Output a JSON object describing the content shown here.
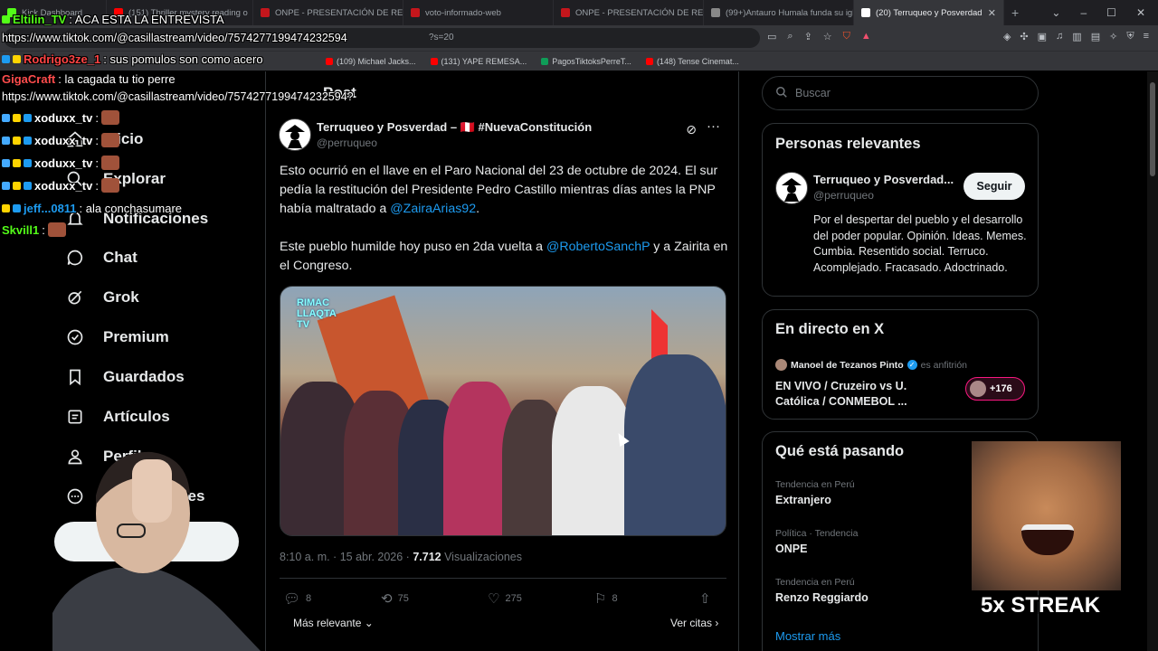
{
  "browser": {
    "tabs": [
      {
        "label": "Kick Dashboard",
        "color": "#53fc18"
      },
      {
        "label": "(151) Thriller mystery reading o",
        "color": "#ff0000"
      },
      {
        "label": "ONPE - PRESENTACIÓN DE RESULT",
        "color": "#c4161c"
      },
      {
        "label": "voto-informado-web",
        "color": "#c4161c"
      },
      {
        "label": "ONPE - PRESENTACIÓN DE RESULT",
        "color": "#c4161c"
      },
      {
        "label": "(99+)Antauro Humala funda su igle",
        "color": "#000000"
      },
      {
        "label": "(20) Terruqueo y Posverdad",
        "color": "#000000",
        "active": true
      }
    ],
    "url_partial": "?s=20",
    "bookmarks": [
      {
        "label": "(109) Michael Jacks...",
        "color": "#ff0000"
      },
      {
        "label": "(131) YAPE REMESA...",
        "color": "#ff0000"
      },
      {
        "label": "PagosTiktoksPerreT...",
        "color": "#0f9d58"
      },
      {
        "label": "(148) Tense Cinemat...",
        "color": "#ff0000"
      }
    ]
  },
  "nav": {
    "items": [
      {
        "label": "Inicio",
        "icon": "home-icon"
      },
      {
        "label": "Explorar",
        "icon": "search-icon"
      },
      {
        "label": "Notificaciones",
        "icon": "bell-icon"
      },
      {
        "label": "Chat",
        "icon": "chat-icon"
      },
      {
        "label": "Grok",
        "icon": "grok-icon"
      },
      {
        "label": "Premium",
        "icon": "premium-icon"
      },
      {
        "label": "Guardados",
        "icon": "bookmark-icon"
      },
      {
        "label": "Artículos",
        "icon": "articles-icon"
      },
      {
        "label": "Perfil",
        "icon": "user-icon"
      },
      {
        "label": "Más opciones",
        "icon": "more-circle-icon"
      }
    ]
  },
  "post": {
    "header_title": "Post",
    "author_name": "Terruqueo y Posverdad – 🇵🇪 #NuevaConstitución",
    "author_handle": "@perruqueo",
    "paragraph1_text": "Esto ocurrió en el llave en el Paro Nacional del 23 de octubre de 2024. El sur pedía la restitución del Presidente Pedro Castillo mientras días antes la PNP había maltratado a ",
    "paragraph1_mention": "@ZairaArias92",
    "paragraph1_end": ".",
    "paragraph2_text": "Este pueblo humilde hoy puso en 2da vuelta a ",
    "paragraph2_mention": "@RobertoSanchP",
    "paragraph2_end": " y a Zairita en el Congreso.",
    "media_logo_line1": "RIMAC",
    "media_logo_line2": "LLAQTA",
    "media_logo_line3": "TV",
    "timestamp": "8:10 a. m. · 15 abr. 2026 · ",
    "views_count": "7.712",
    "views_label": " Visualizaciones",
    "replies": "8",
    "reposts": "75",
    "likes": "275",
    "bookmarks": "8",
    "sort_label": "Más relevante",
    "quotes_label": "Ver citas"
  },
  "right": {
    "search_placeholder": "Buscar",
    "relevant_title": "Personas relevantes",
    "relevant_name": "Terruqueo y Posverdad...",
    "relevant_handle": "@perruqueo",
    "follow_label": "Seguir",
    "relevant_bio": "Por el despertar del pueblo y el desarrollo del poder popular. Opinión. Ideas. Memes. Cumbia. Resentido social. Terruco. Acomplejado. Fracasado. Adoctrinado.",
    "live_title": "En directo en X",
    "live_host": "Manoel de Tezanos Pinto",
    "live_host_role": "es anfitrión",
    "live_event": "EN VIVO / Cruzeiro vs U. Católica / CONMEBOL ...",
    "live_count": "+176",
    "trends_title": "Qué está pasando",
    "trends": [
      {
        "category": "Tendencia en Perú",
        "name": "Extranjero"
      },
      {
        "category": "Política · Tendencia",
        "name": "ONPE"
      },
      {
        "category": "Tendencia en Perú",
        "name": "Renzo Reggiardo"
      }
    ],
    "show_more": "Mostrar más"
  },
  "overlay": {
    "chat": [
      {
        "user": "Eltilin_TV",
        "user_color": "#53fc18",
        "msg": ": ACA ESTA LA ENTREVISTA"
      },
      {
        "user": "",
        "user_color": "#ffffff",
        "msg": "https://www.tiktok.com/@casillastream/video/7574277199474232594"
      },
      {
        "user": "Rodrigo3ze_1",
        "user_color": "#ff4444",
        "msg": ": sus pomulos son como acero"
      },
      {
        "user": "GigaCraft",
        "user_color": "#ff4c4c",
        "msg": ": la cagada tu tio perre"
      },
      {
        "user": "",
        "user_color": "#ffffff",
        "msg": "https://www.tiktok.com/@casillastream/video/7574277199474232594?"
      },
      {
        "user": "xoduxx_tv",
        "user_color": "#ffffff",
        "msg": ":"
      },
      {
        "user": "xoduxx_tv",
        "user_color": "#ffffff",
        "msg": ":"
      },
      {
        "user": "xoduxx_tv",
        "user_color": "#ffffff",
        "msg": ":"
      },
      {
        "user": "xoduxx_tv",
        "user_color": "#ffffff",
        "msg": ":"
      },
      {
        "user": "jeff...0811",
        "user_color": "#1d9bf0",
        "msg": ": ala conchasumare"
      },
      {
        "user": "Skvill1",
        "user_color": "#53fc18",
        "msg": ":"
      }
    ],
    "streak_text": "5x STREAK"
  }
}
